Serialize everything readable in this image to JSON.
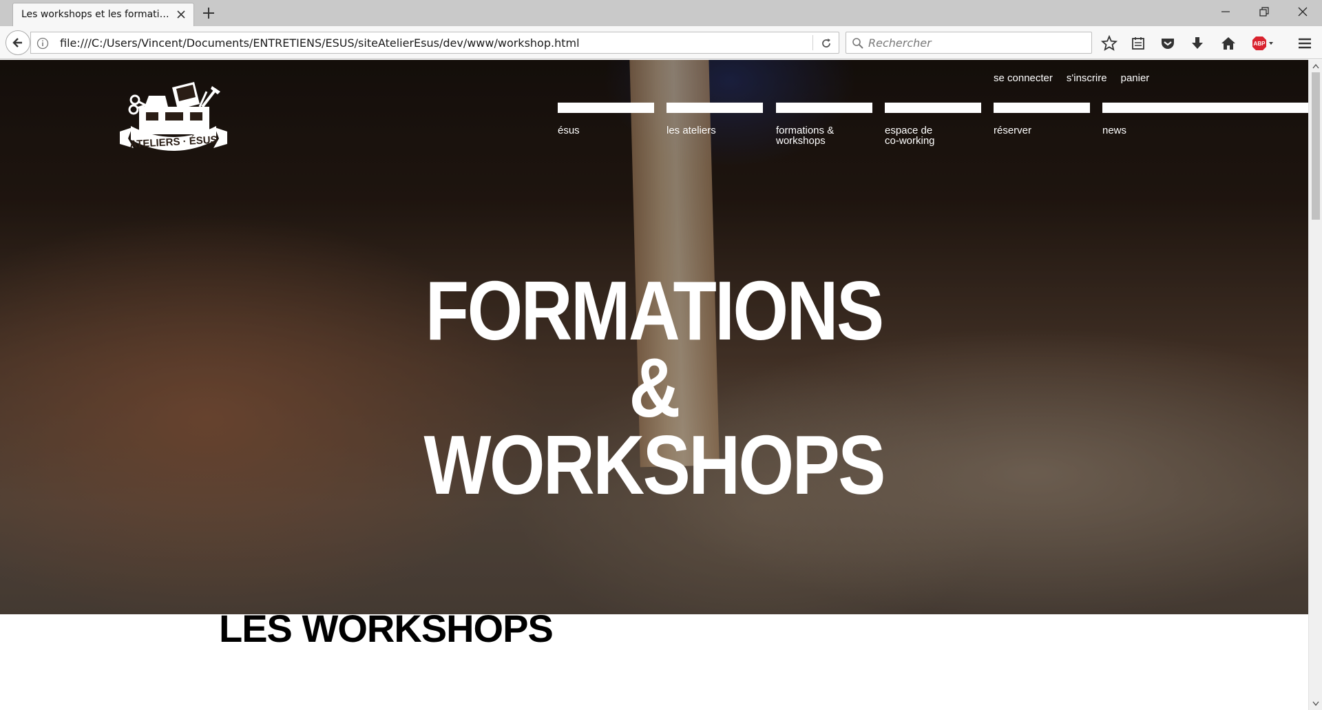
{
  "browser": {
    "tab_title": "Les workshops et les formatio…",
    "url": "file:///C:/Users/Vincent/Documents/ENTRETIENS/ESUS/siteAtelierEsus/dev/www/workshop.html",
    "search_placeholder": "Rechercher",
    "adblock_label": "ABP"
  },
  "site": {
    "logo_text": "ATELIERS · ÉSUS",
    "top_links": [
      "se connecter",
      "s'inscrire",
      "panier"
    ],
    "nav": [
      {
        "label": "ésus"
      },
      {
        "label": "les ateliers"
      },
      {
        "label": "formations & workshops"
      },
      {
        "label": "espace de co-working"
      },
      {
        "label": "réserver"
      },
      {
        "label": "news"
      }
    ],
    "hero_title": [
      "FORMATIONS",
      "&",
      "WORKSHOPS"
    ],
    "section_title": "LES WORKSHOPS"
  }
}
